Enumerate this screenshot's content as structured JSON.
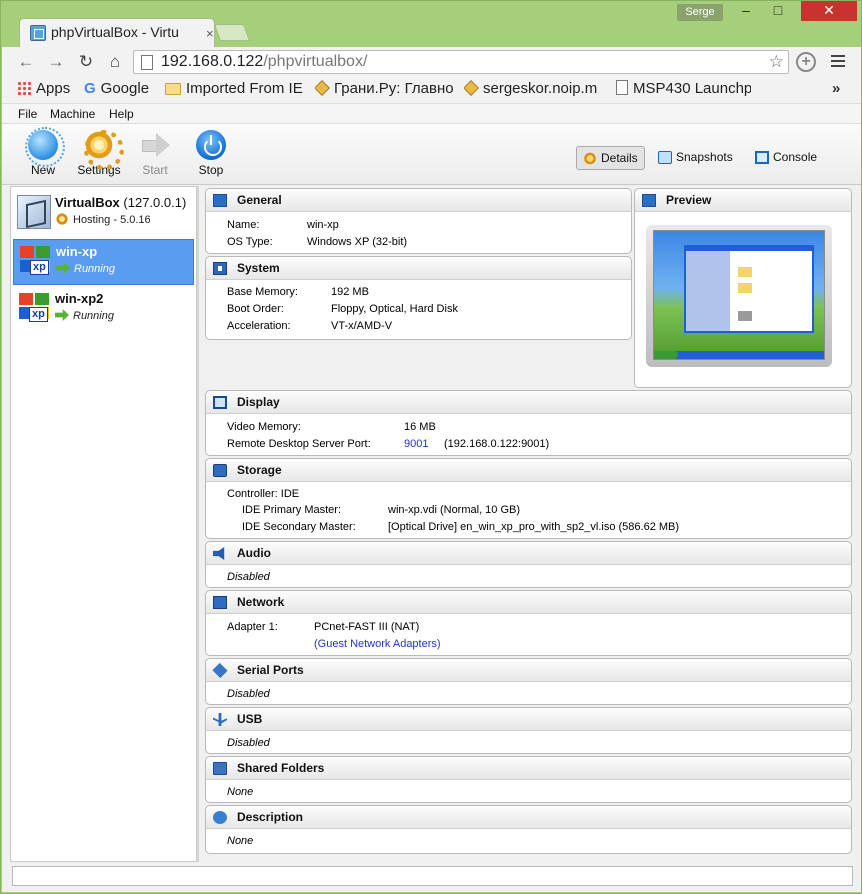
{
  "browser": {
    "tab_title": "phpVirtualBox - Virtu",
    "tab_close": "×",
    "user": "Serge",
    "window_controls": {
      "minimize": "–",
      "maximize": "□",
      "close": "✕"
    },
    "nav": {
      "back": "←",
      "forward": "→",
      "reload": "↻",
      "home": "⌂"
    },
    "url_host": "192.168.0.122",
    "url_path": "/phpvirtualbox/",
    "star": "☆",
    "add": "+",
    "bookmarks": [
      {
        "label": "Apps",
        "icon": "apps-grid-icon"
      },
      {
        "label": "Google",
        "icon": "google-icon"
      },
      {
        "label": "Imported From IE",
        "icon": "folder-icon"
      },
      {
        "label": "Грани.Ру: Главно",
        "icon": "box-icon"
      },
      {
        "label": "sergeskor.noip.m",
        "icon": "box-icon"
      },
      {
        "label": "MSP430 Launchp",
        "icon": "page-icon"
      }
    ],
    "bookmarks_more": "»"
  },
  "menu": {
    "file": "File",
    "machine": "Machine",
    "help": "Help"
  },
  "toolbar": {
    "new": "New",
    "settings": "Settings",
    "start": "Start",
    "stop": "Stop",
    "details": "Details",
    "snapshots": "Snapshots",
    "console": "Console"
  },
  "vms": [
    {
      "name": "VirtualBox",
      "host": "(127.0.0.1)",
      "state": "Hosting - 5.0.16"
    },
    {
      "name": "win-xp",
      "state": "Running",
      "selected": true
    },
    {
      "name": "win-xp2",
      "state": "Running"
    }
  ],
  "xp_tag": "xp",
  "general": {
    "title": "General",
    "name_label": "Name:",
    "name": "win-xp",
    "os_label": "OS Type:",
    "os": "Windows XP (32-bit)"
  },
  "system": {
    "title": "System",
    "mem_label": "Base Memory:",
    "mem": "192 MB",
    "boot_label": "Boot Order:",
    "boot": "Floppy, Optical, Hard Disk",
    "accel_label": "Acceleration:",
    "accel": "VT-x/AMD-V"
  },
  "preview": {
    "title": "Preview"
  },
  "display": {
    "title": "Display",
    "vmem_label": "Video Memory:",
    "vmem": "16 MB",
    "rdp_label": "Remote Desktop Server Port:",
    "rdp_port": "9001",
    "rdp_addr": "(192.168.0.122:9001)"
  },
  "storage": {
    "title": "Storage",
    "controller": "Controller: IDE",
    "primary_label": "IDE Primary Master:",
    "primary": "win-xp.vdi (Normal, 10 GB)",
    "secondary_label": "IDE Secondary Master:",
    "secondary": "[Optical Drive] en_win_xp_pro_with_sp2_vl.iso (586.62 MB)"
  },
  "audio": {
    "title": "Audio",
    "value": "Disabled"
  },
  "network": {
    "title": "Network",
    "adapter_label": "Adapter 1:",
    "adapter": "PCnet-FAST III (NAT)",
    "guest_link": "(Guest Network Adapters)"
  },
  "serial": {
    "title": "Serial Ports",
    "value": "Disabled"
  },
  "usb": {
    "title": "USB",
    "value": "Disabled"
  },
  "shared": {
    "title": "Shared Folders",
    "value": "None"
  },
  "description": {
    "title": "Description",
    "value": "None"
  }
}
